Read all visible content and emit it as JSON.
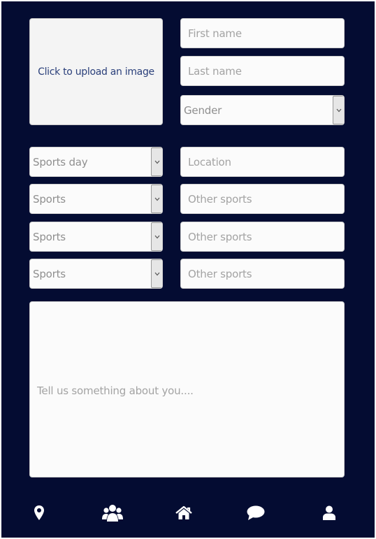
{
  "profile": {
    "upload_label": "Click to upload an image",
    "first_name_placeholder": "First name",
    "last_name_placeholder": "Last name",
    "gender_selected": "Gender"
  },
  "sports": {
    "sports_day_selected": "Sports day",
    "location_placeholder": "Location",
    "rows": [
      {
        "sport_selected": "Sports",
        "other_placeholder": "Other sports"
      },
      {
        "sport_selected": "Sports",
        "other_placeholder": "Other sports"
      },
      {
        "sport_selected": "Sports",
        "other_placeholder": "Other sports"
      }
    ]
  },
  "about": {
    "placeholder": "Tell us something about you...."
  },
  "nav": {
    "items": [
      {
        "icon": "map-marker-icon"
      },
      {
        "icon": "users-icon"
      },
      {
        "icon": "home-icon"
      },
      {
        "icon": "chat-bubble-icon"
      },
      {
        "icon": "user-icon"
      }
    ]
  },
  "colors": {
    "background": "#040c32",
    "upload_text": "#2a3f7a",
    "field_background": "#fbfbfb",
    "icon": "#ffffff"
  }
}
